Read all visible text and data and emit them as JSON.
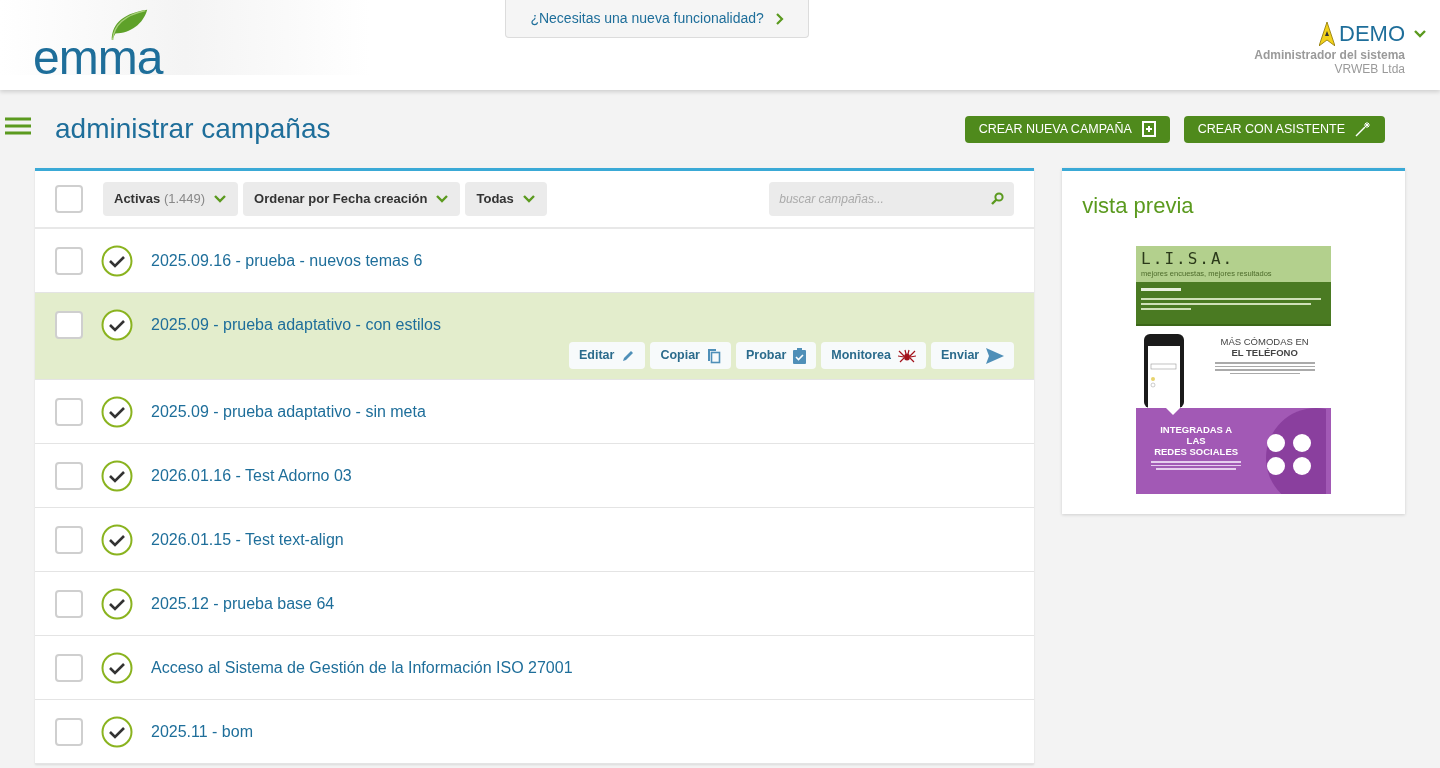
{
  "logo": {
    "text": "emma"
  },
  "feature_link": {
    "label": "¿Necesitas una nueva funcionalidad?"
  },
  "user": {
    "name": "DEMO",
    "role": "Administrador del sistema",
    "company": "VRWEB Ltda"
  },
  "page_title": "administrar campañas",
  "header_buttons": [
    {
      "label": "CREAR NUEVA CAMPAÑA",
      "kind": "new"
    },
    {
      "label": "CREAR CON ASISTENTE",
      "kind": "wizard"
    }
  ],
  "toolbar": {
    "select_all_checked": false,
    "filters": [
      {
        "label": "Activas",
        "count": "(1.449)"
      },
      {
        "label": "Ordenar por Fecha creación"
      },
      {
        "label": "Todas"
      }
    ],
    "search": {
      "placeholder": "buscar campañas..."
    }
  },
  "campaigns": [
    {
      "title": "2025.09.16 - prueba - nuevos temas 6",
      "checked": false,
      "highlighted": false
    },
    {
      "title": "2025.09 - prueba adaptativo - con estilos",
      "checked": false,
      "highlighted": true,
      "actions": [
        {
          "label": "Editar",
          "kind": "edit"
        },
        {
          "label": "Copiar",
          "kind": "copy"
        },
        {
          "label": "Probar",
          "kind": "test"
        },
        {
          "label": "Monitorea",
          "kind": "monitor"
        },
        {
          "label": "Enviar",
          "kind": "send"
        }
      ]
    },
    {
      "title": "2025.09 - prueba adaptativo - sin meta",
      "checked": false,
      "highlighted": false
    },
    {
      "title": "2026.01.16 - Test Adorno 03",
      "checked": false,
      "highlighted": false
    },
    {
      "title": "2026.01.15 - Test text-align",
      "checked": false,
      "highlighted": false
    },
    {
      "title": "2025.12 - prueba base 64",
      "checked": false,
      "highlighted": false
    },
    {
      "title": "Acceso al Sistema de Gestión de la Información ISO 27001",
      "checked": false,
      "highlighted": false
    },
    {
      "title": "2025.11 - bom",
      "checked": false,
      "highlighted": false
    }
  ],
  "preview": {
    "title": "vista previa",
    "email": {
      "brand": "L.I.S.A.",
      "tagline": "mejores encuestas, mejores resultados",
      "phone_heading": [
        "MÁS CÓMODAS EN",
        "EL TELÉFONO"
      ],
      "social_heading": [
        "INTEGRADAS A",
        "LAS",
        "REDES SOCIALES"
      ]
    }
  }
}
